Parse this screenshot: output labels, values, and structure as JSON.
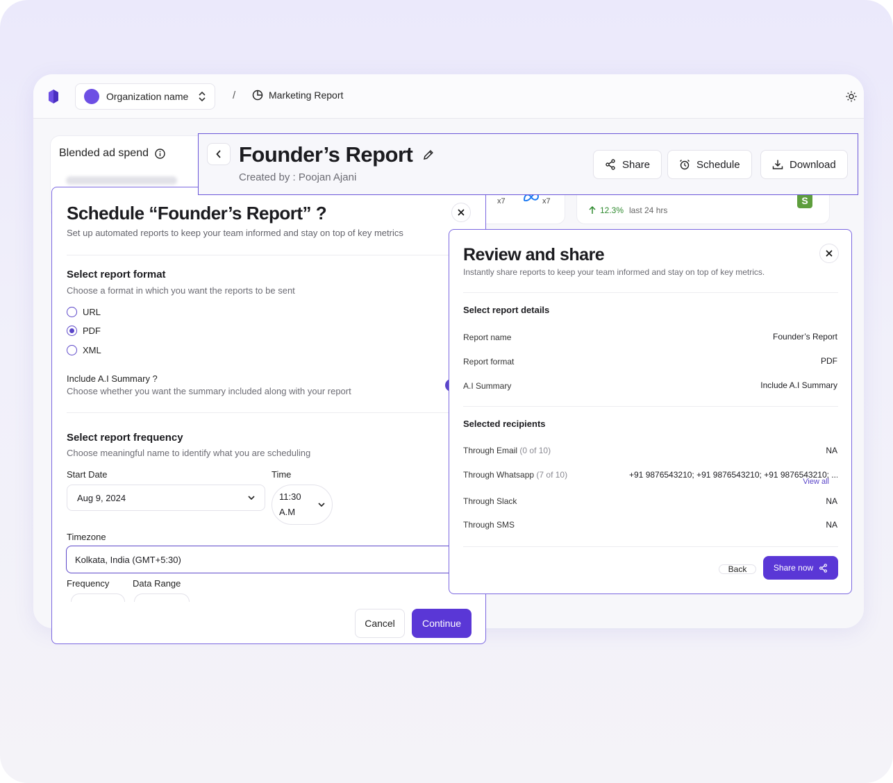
{
  "topbar": {
    "org_name": "Organization name",
    "separator": "/",
    "report_crumb": "Marketing Report"
  },
  "background_cards": {
    "blended_label": "Blended ad spend",
    "count_a": "x7",
    "count_b": "x7",
    "change": "12.3%",
    "period": "last 24 hrs"
  },
  "report_header": {
    "title": "Founder’s Report",
    "created_by": "Created by : Poojan Ajani",
    "share_label": "Share",
    "schedule_label": "Schedule",
    "download_label": "Download"
  },
  "schedule_modal": {
    "title": "Schedule “Founder’s Report” ?",
    "description": "Set up automated reports to keep your team informed and stay on top of key metrics",
    "format_title": "Select report format",
    "format_sub": "Choose a format in which you want the reports to be sent",
    "formats": [
      "URL",
      "PDF",
      "XML"
    ],
    "selected_format": "PDF",
    "summary_title": "Include A.I Summary ?",
    "summary_sub": "Choose whether you want the summary included along with your report",
    "frequency_title": "Select report frequency",
    "frequency_sub": "Choose meaningful name to identify what you are scheduling",
    "start_date_label": "Start Date",
    "start_date_value": "Aug 9, 2024",
    "time_label": "Time",
    "time_value_1": "11:30",
    "time_value_2": "A.M",
    "timezone_label": "Timezone",
    "timezone_value": "Kolkata, India (GMT+5:30)",
    "frequency_label": "Frequency",
    "data_range_label": "Data Range",
    "cancel_label": "Cancel",
    "continue_label": "Continue"
  },
  "review_modal": {
    "title": "Review and share",
    "description": "Instantly share reports to keep your team informed and stay on top of key metrics.",
    "details_title": "Select report details",
    "details": [
      {
        "key": "Report name",
        "value": "Founder’s Report"
      },
      {
        "key": "Report format",
        "value": "PDF"
      },
      {
        "key": "A.I Summary",
        "value": "Include A.I Summary"
      }
    ],
    "recipients_title": "Selected recipients",
    "recipients": [
      {
        "key": "Through Email",
        "count": "(0 of 10)",
        "value": "NA"
      },
      {
        "key": "Through Whatsapp",
        "count": "(7 of 10)",
        "value": "+91 9876543210; +91 9876543210; +91 9876543210; ..."
      },
      {
        "key": "Through Slack",
        "count": "",
        "value": "NA"
      },
      {
        "key": "Through SMS",
        "count": "",
        "value": "NA"
      }
    ],
    "view_all": "View all",
    "back_label": "Back",
    "share_now_label": "Share now"
  },
  "colors": {
    "accent": "#5a37d6",
    "border_accent": "#7a66e0",
    "positive": "#2f8a2f"
  }
}
